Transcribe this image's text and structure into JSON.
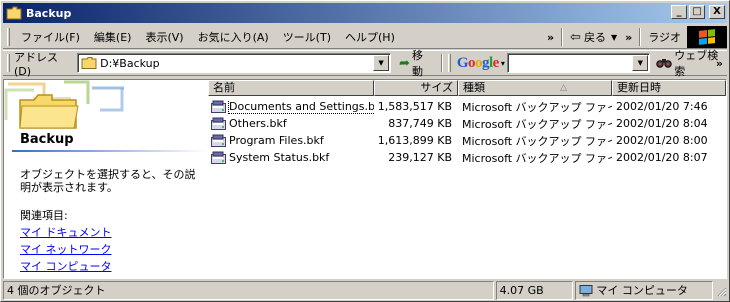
{
  "window": {
    "title": "Backup",
    "controls": {
      "minimize": "_",
      "maximize": "□",
      "close": "X"
    }
  },
  "menubar": {
    "items": [
      "ファイル(F)",
      "編集(E)",
      "表示(V)",
      "お気に入り(A)",
      "ツール(T)",
      "ヘルプ(H)"
    ],
    "chevron": "»",
    "back_label": "戻る",
    "radio_label": "ラジオ"
  },
  "addressbar": {
    "label": "アドレス(D)",
    "value": "D:¥Backup",
    "go_label": "移動",
    "google_letters": [
      "G",
      "o",
      "o",
      "g",
      "l",
      "e"
    ],
    "search_value": "",
    "web_search_label": "ウェブ検索",
    "chevron": "»"
  },
  "leftpane": {
    "title": "Backup",
    "description": "オブジェクトを選択すると、その説明が表示されます。",
    "related_label": "関連項目:",
    "links": [
      "マイ ドキュメント",
      "マイ ネットワーク",
      "マイ コンピュータ"
    ]
  },
  "filelist": {
    "columns": {
      "name": "名前",
      "size": "サイズ",
      "type": "種類",
      "date": "更新日時"
    },
    "sort_indicator": "△",
    "files": [
      {
        "name": "Documents and Settings.bkf",
        "size": "1,583,517 KB",
        "type": "Microsoft バックアップ ファイル",
        "date": "2002/01/20 7:46"
      },
      {
        "name": "Others.bkf",
        "size": "837,749 KB",
        "type": "Microsoft バックアップ ファイル",
        "date": "2002/01/20 8:04"
      },
      {
        "name": "Program Files.bkf",
        "size": "1,613,899 KB",
        "type": "Microsoft バックアップ ファイル",
        "date": "2002/01/20 8:00"
      },
      {
        "name": "System Status.bkf",
        "size": "239,127 KB",
        "type": "Microsoft バックアップ ファイル",
        "date": "2002/01/20 8:07"
      }
    ]
  },
  "statusbar": {
    "objects": "4 個のオブジェクト",
    "size": "4.07 GB",
    "location": "マイ コンピュータ"
  }
}
